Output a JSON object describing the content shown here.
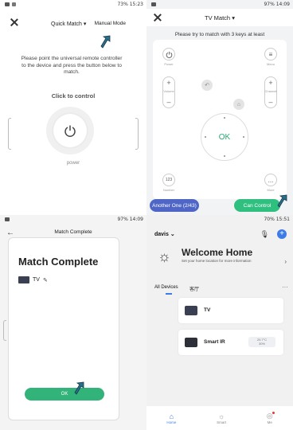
{
  "colors": {
    "accent_green": "#2fbf7e",
    "accent_blue": "#4f66c7",
    "brand_blue": "#3d7be8"
  },
  "panel1": {
    "status": {
      "right": "73% 15:23"
    },
    "title": "Quick Match",
    "manual_mode": "Manual Mode",
    "instruction": "Please point the universal remote controller to the device and press the button below to match.",
    "click_to_control": "Click to control",
    "power_label": "power"
  },
  "panel2": {
    "status": {
      "right": "97% 14:09"
    },
    "title": "TV Match",
    "subtitle": "Please try to match with 3 keys at least",
    "labels": {
      "power": "Power",
      "menu": "Menu",
      "volume": "Volume",
      "channel": "Channel",
      "number": "Number",
      "more": "More"
    },
    "ok": "OK",
    "num": "123",
    "more": "...",
    "another_one": "Another One (2/43)",
    "can_control": "Can Control"
  },
  "panel3": {
    "status": {
      "right": "97% 14:09"
    },
    "title": "Match Complete",
    "heading": "Match Complete",
    "device": "TV",
    "ok_button": "OK"
  },
  "panel4": {
    "status": {
      "right": "70% 15:51"
    },
    "user": "davis",
    "welcome_title": "Welcome Home",
    "welcome_sub": "Set your home location for more information",
    "tabs": {
      "all": "All Devices",
      "room": "客厅"
    },
    "devices": [
      {
        "name": "TV",
        "info": ""
      },
      {
        "name": "Smart IR",
        "info": "20.7°C\n30%"
      }
    ],
    "nav": {
      "home": "Home",
      "smart": "Smart",
      "me": "Me"
    }
  }
}
